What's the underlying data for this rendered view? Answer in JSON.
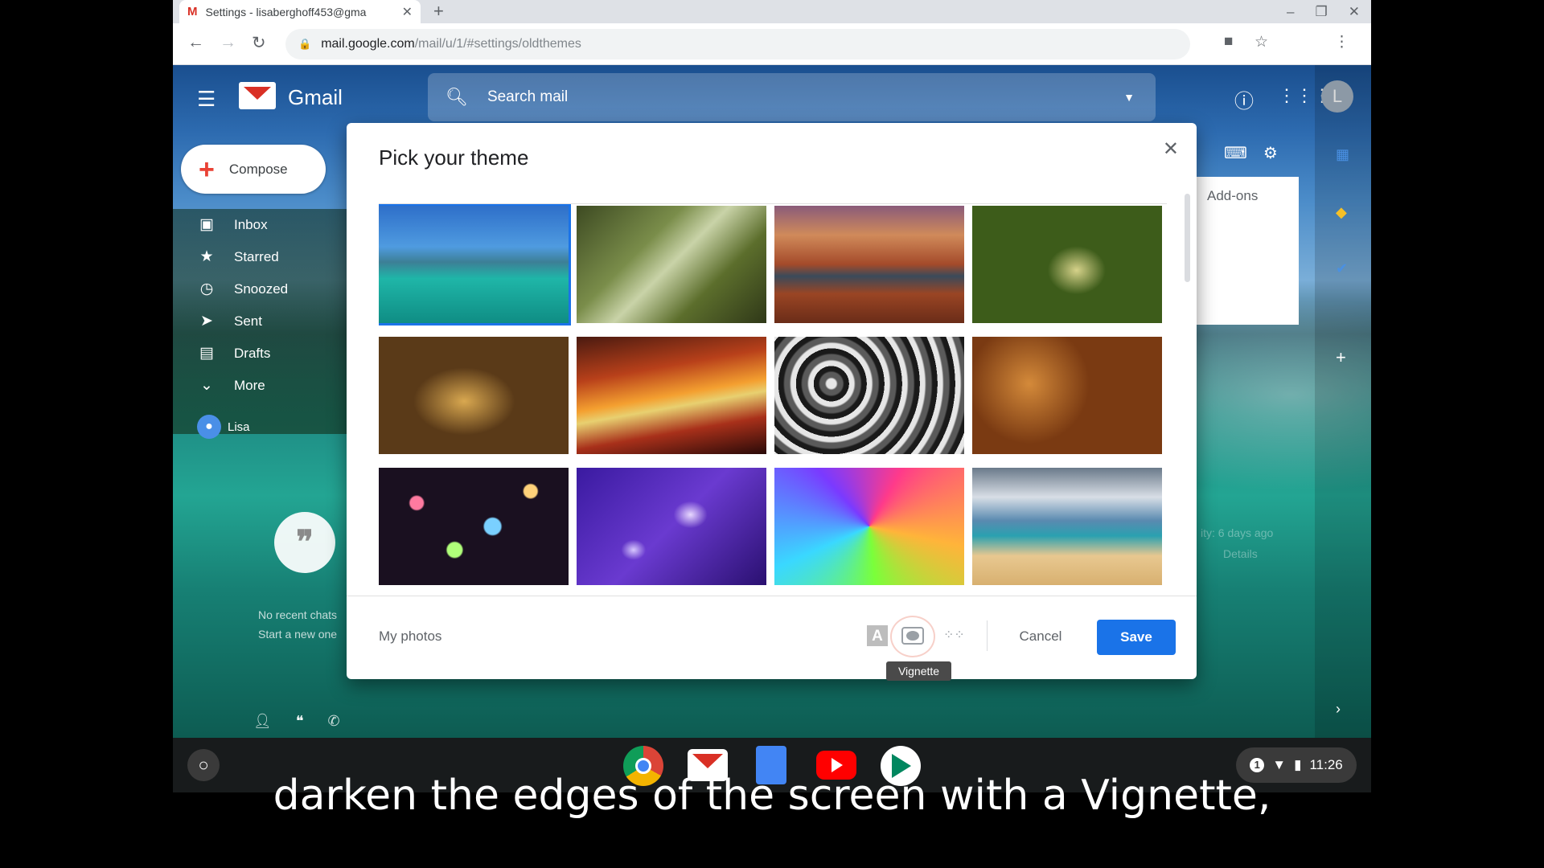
{
  "browser": {
    "tab_title": "Settings - lisaberghoff453@gma",
    "new_tab": "+",
    "url_host": "mail.google.com",
    "url_path": "/mail/u/1/#settings/oldthemes"
  },
  "gmail": {
    "logo_text": "Gmail",
    "search_placeholder": "Search mail",
    "avatar_letter": "L",
    "compose_label": "Compose",
    "nav": [
      {
        "label": "Inbox",
        "icon": "inbox-icon"
      },
      {
        "label": "Starred",
        "icon": "star-icon"
      },
      {
        "label": "Snoozed",
        "icon": "clock-icon"
      },
      {
        "label": "Sent",
        "icon": "send-icon"
      },
      {
        "label": "Drafts",
        "icon": "draft-icon"
      },
      {
        "label": "More",
        "icon": "chevron-down-icon"
      }
    ],
    "user_name": "Lisa",
    "no_chats": "No recent chats",
    "start_chat": "Start a new one",
    "addons_label": "Add-ons",
    "activity_text": "ity: 6 days ago",
    "details_text": "Details"
  },
  "modal": {
    "title": "Pick your theme",
    "my_photos": "My photos",
    "text_icon": "A",
    "cancel": "Cancel",
    "save": "Save",
    "tooltip": "Vignette",
    "themes": [
      {
        "name": "lake",
        "selected": true
      },
      {
        "name": "forest",
        "selected": false
      },
      {
        "name": "canyon",
        "selected": false
      },
      {
        "name": "caterpillar",
        "selected": false
      },
      {
        "name": "chess",
        "selected": false
      },
      {
        "name": "antelope-canyon",
        "selected": false
      },
      {
        "name": "pipes",
        "selected": false
      },
      {
        "name": "autumn-leaves",
        "selected": false
      },
      {
        "name": "bokeh",
        "selected": false
      },
      {
        "name": "jellyfish",
        "selected": false
      },
      {
        "name": "bubble",
        "selected": false
      },
      {
        "name": "beach",
        "selected": false
      }
    ]
  },
  "shelf": {
    "notification_count": "1",
    "time": "11:26"
  },
  "caption": "darken the edges of the screen with a Vignette,",
  "colors": {
    "accent": "#1a73e8",
    "gmail_red": "#d93025"
  }
}
